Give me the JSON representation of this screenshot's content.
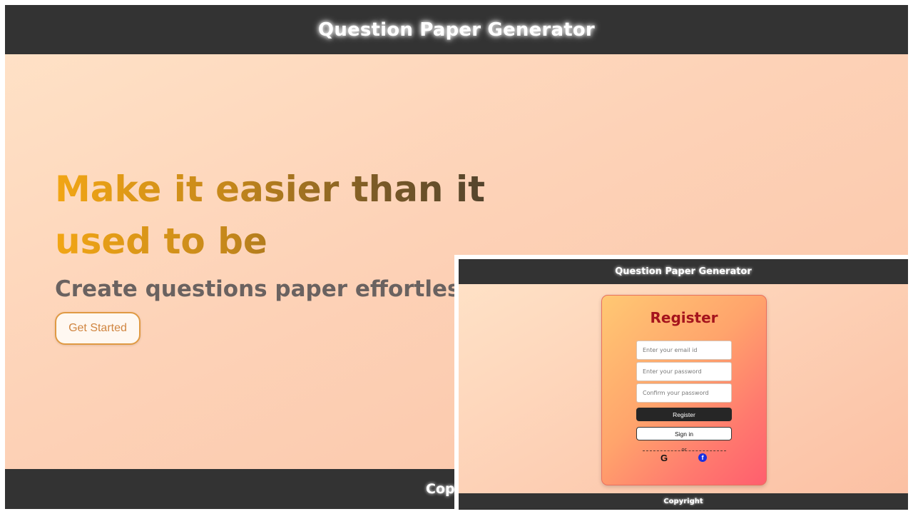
{
  "landing": {
    "header": {
      "title": "Question Paper Generator"
    },
    "hero": {
      "heading": "Make it easier than it used to be",
      "subheading": "Create questions paper effortlessly, Si",
      "cta_label": "Get Started"
    },
    "footer": {
      "copyright": "Copyright"
    }
  },
  "register_page": {
    "header": {
      "title": "Question Paper Generator"
    },
    "form": {
      "heading": "Register",
      "email_placeholder": "Enter your email id",
      "password_placeholder": "Enter your password",
      "confirm_placeholder": "Confirm your password",
      "register_label": "Register",
      "signin_label": "Sign in",
      "divider_text": "or",
      "google_icon": "G",
      "facebook_icon": "f"
    },
    "footer": {
      "copyright": "Copyright"
    }
  },
  "colors": {
    "header_bg": "#333333",
    "accent_orange": "#f2a615",
    "register_heading": "#a5141d",
    "facebook_blue": "#1a2fe0"
  }
}
